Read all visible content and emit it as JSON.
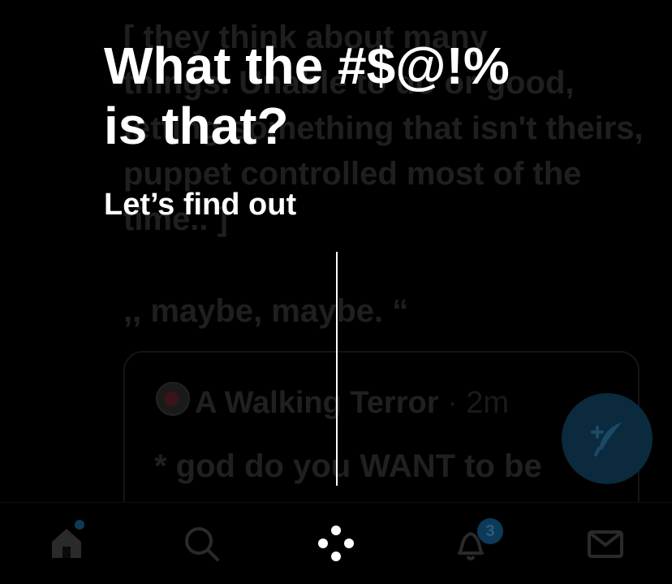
{
  "background": {
    "paragraph_lines": [
      "[ they think about many",
      "things. Unable to do or good,",
      "letting something that isn't theirs,",
      "puppet controlled most of the",
      "time.. ]"
    ],
    "quote_line": ",, maybe, maybe. “",
    "quoted_post": {
      "author": "A Walking Terror",
      "time": "· 2m",
      "body": "* god do you WANT to be"
    }
  },
  "overlay": {
    "title": "What the #$@!% is that?",
    "subtitle": "Let’s find out"
  },
  "tabbar": {
    "notification_count": "3",
    "icons": [
      "home-icon",
      "search-icon",
      "spaces-icon",
      "notifications-icon",
      "messages-icon"
    ]
  },
  "colors": {
    "background": "#000000",
    "overlay_text": "#ffffff",
    "dimmed_text": "#1f1f1f",
    "accent": "#0c3a58"
  }
}
